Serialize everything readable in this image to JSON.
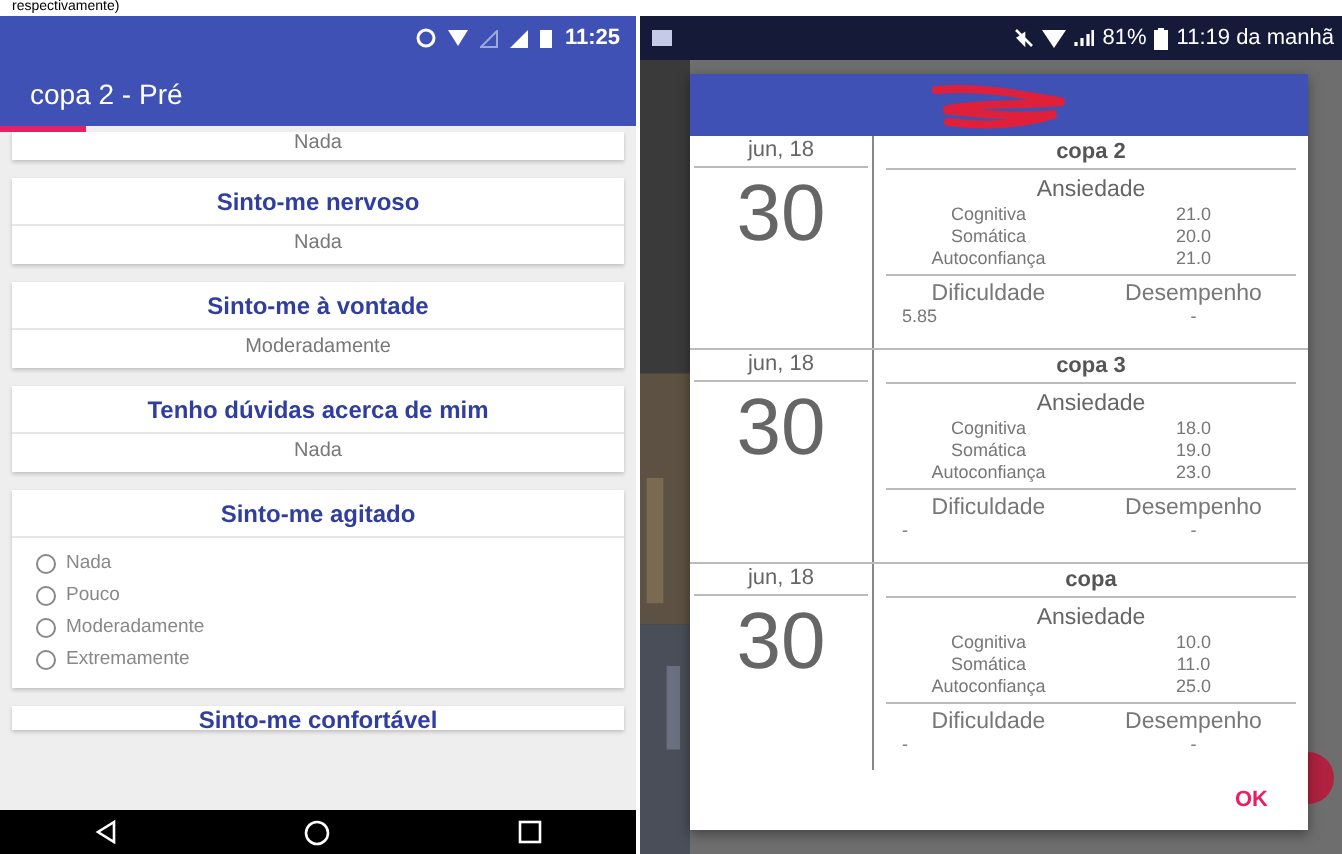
{
  "caption": "respectivamente)",
  "left_phone": {
    "status_bar": {
      "time": "11:25"
    },
    "app_bar": {
      "title": "copa 2 - Pré"
    },
    "questions": [
      {
        "kind": "answered",
        "answer": "Nada"
      },
      {
        "kind": "answered",
        "title": "Sinto-me nervoso",
        "answer": "Nada"
      },
      {
        "kind": "answered",
        "title": "Sinto-me à vontade",
        "answer": "Moderadamente"
      },
      {
        "kind": "answered",
        "title": "Tenho dúvidas acerca de mim",
        "answer": "Nada"
      },
      {
        "kind": "choice",
        "title": "Sinto-me agitado",
        "options": [
          {
            "label": "Nada",
            "selected": false
          },
          {
            "label": "Pouco",
            "selected": false
          },
          {
            "label": "Moderadamente",
            "selected": false
          },
          {
            "label": "Extremamente",
            "selected": false
          }
        ]
      },
      {
        "kind": "heading",
        "title": "Sinto-me confortável"
      }
    ]
  },
  "right_phone": {
    "status_bar": {
      "battery": "81%",
      "time": "11:19 da manhã"
    },
    "dialog": {
      "entries": [
        {
          "month": "jun, 18",
          "day": "30",
          "name": "copa 2",
          "section": "Ansiedade",
          "scores": [
            {
              "label": "Cognitiva",
              "value": "21.0"
            },
            {
              "label": "Somática",
              "value": "20.0"
            },
            {
              "label": "Autoconfiança",
              "value": "21.0"
            }
          ],
          "columns": [
            {
              "label": "Dificuldade",
              "value": "5.85"
            },
            {
              "label": "Desempenho",
              "value": "-"
            }
          ]
        },
        {
          "month": "jun, 18",
          "day": "30",
          "name": "copa 3",
          "section": "Ansiedade",
          "scores": [
            {
              "label": "Cognitiva",
              "value": "18.0"
            },
            {
              "label": "Somática",
              "value": "19.0"
            },
            {
              "label": "Autoconfiança",
              "value": "23.0"
            }
          ],
          "columns": [
            {
              "label": "Dificuldade",
              "value": "-"
            },
            {
              "label": "Desempenho",
              "value": "-"
            }
          ]
        },
        {
          "month": "jun, 18",
          "day": "30",
          "name": "copa",
          "section": "Ansiedade",
          "scores": [
            {
              "label": "Cognitiva",
              "value": "10.0"
            },
            {
              "label": "Somática",
              "value": "11.0"
            },
            {
              "label": "Autoconfiança",
              "value": "25.0"
            }
          ],
          "columns": [
            {
              "label": "Dificuldade",
              "value": "-"
            },
            {
              "label": "Desempenho",
              "value": "-"
            }
          ]
        }
      ],
      "ok": "OK"
    }
  }
}
